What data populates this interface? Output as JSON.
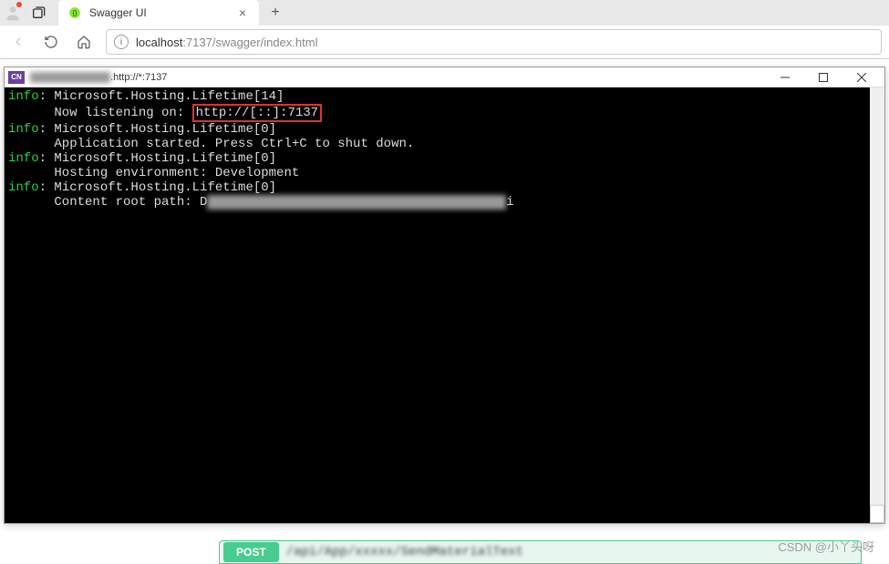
{
  "browser": {
    "tab_title": "Swagger UI",
    "url_host": "localhost",
    "url_path": ":7137/swagger/index.html"
  },
  "terminal": {
    "icon_label": "CN",
    "title_suffix": ".http://*:7137",
    "lines": [
      {
        "tag": "info",
        "text": ": Microsoft.Hosting.Lifetime[14]"
      },
      {
        "tag": "",
        "text": "      Now listening on: ",
        "box": "http://[::]:7137"
      },
      {
        "tag": "info",
        "text": ": Microsoft.Hosting.Lifetime[0]"
      },
      {
        "tag": "",
        "text": "      Application started. Press Ctrl+C to shut down."
      },
      {
        "tag": "info",
        "text": ": Microsoft.Hosting.Lifetime[0]"
      },
      {
        "tag": "",
        "text": "      Hosting environment: Development"
      },
      {
        "tag": "info",
        "text": ": Microsoft.Hosting.Lifetime[0]"
      },
      {
        "tag": "",
        "text": "      Content root path: D",
        "blur_after": "xxxxxxxxxxxxxxxxxxxxxxxxxxxxxxxxxxxxxxx",
        "suffix": "i"
      }
    ]
  },
  "swagger": {
    "method": "POST",
    "endpoint": "/api/App/xxxxx/SendMaterialText"
  },
  "watermark": "CSDN @小丫头呀"
}
